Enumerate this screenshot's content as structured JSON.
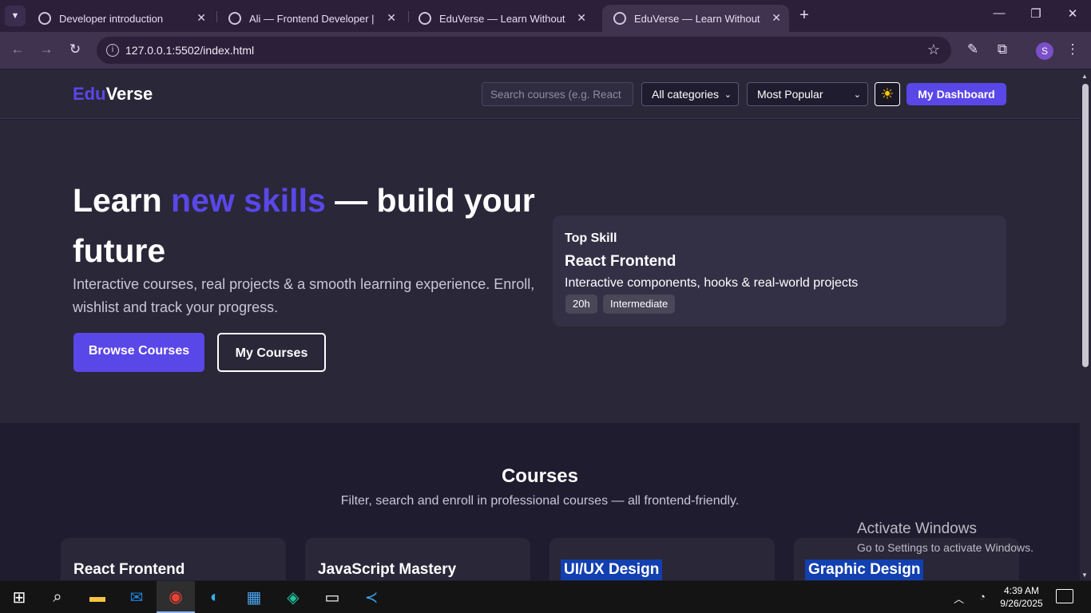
{
  "browser": {
    "tabs": [
      {
        "title": "Developer introduction",
        "active": false
      },
      {
        "title": "Ali — Frontend Developer | HD",
        "active": false
      },
      {
        "title": "EduVerse — Learn Without Limits",
        "active": false
      },
      {
        "title": "EduVerse — Learn Without Limits",
        "active": true
      }
    ],
    "url": "127.0.0.1:5502/index.html",
    "profile_initial": "S"
  },
  "site": {
    "logo_accent": "Edu",
    "logo_rest": "Verse",
    "search_placeholder": "Search courses (e.g. React",
    "category_select": "All categories",
    "sort_select": "Most Popular",
    "theme_icon": "☀",
    "dashboard_button": "My Dashboard",
    "accent_color": "#5a47e8"
  },
  "hero": {
    "title_pre": "Learn ",
    "title_accent": "new skills",
    "title_post": " — build your future",
    "subtitle": "Interactive courses, real projects & a smooth learning experience. Enroll, wishlist and track your progress.",
    "primary_button": "Browse Courses",
    "secondary_button": "My Courses"
  },
  "top_skill": {
    "label": "Top Skill",
    "title": "React Frontend",
    "description": "Interactive components, hooks & real-world projects",
    "badges": [
      "20h",
      "Intermediate"
    ]
  },
  "courses": {
    "title": "Courses",
    "subtitle": "Filter, search and enroll in professional courses — all frontend-friendly.",
    "cards": [
      {
        "title": "React Frontend",
        "highlighted": false
      },
      {
        "title": "JavaScript Mastery",
        "highlighted": false
      },
      {
        "title": "UI/UX Design",
        "highlighted": true
      },
      {
        "title": "Graphic Design",
        "highlighted": true
      }
    ]
  },
  "watermark": {
    "line1": "Activate Windows",
    "line2": "Go to Settings to activate Windows."
  },
  "taskbar": {
    "time": "4:39 AM",
    "date": "9/26/2025"
  }
}
